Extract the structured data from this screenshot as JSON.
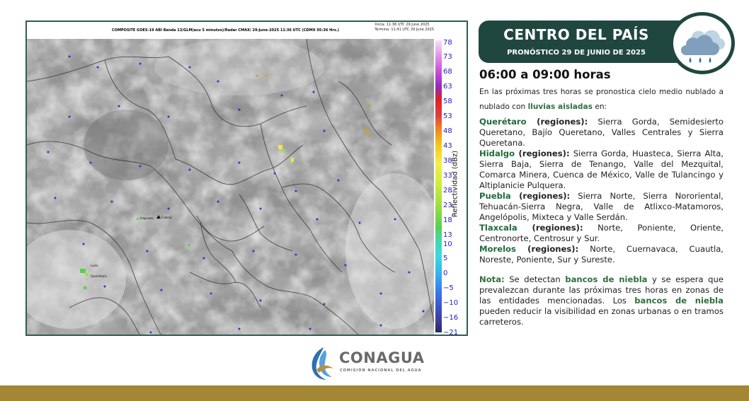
{
  "map": {
    "caption": "COMPOSITE GOES-19 ABI Banda 13/GLM(acu 5 minutos)/Radar CMAX/ 29-June-2025 11:36 UTC  (CDMX  05:36 Hrs.)",
    "start_time": "Inicia: 11:36 UTC 29 June 2025",
    "end_time": "Termina: 11:41 UTC 29 June 2025",
    "scale_label": "Reflectividad (dBz)",
    "scale_ticks": [
      "78",
      "73",
      "68",
      "63",
      "58",
      "53",
      "48",
      "43",
      "38",
      "33",
      "28",
      "23",
      "18",
      "13",
      "10",
      "5",
      "0",
      "−5",
      "−10",
      "−16",
      "−21"
    ],
    "places": {
      "cabral": "Cabral",
      "irapuato": "Irapuato",
      "leon": "León",
      "queretaro": "Querétaro"
    }
  },
  "banner": {
    "title": "CENTRO DEL PAÍS",
    "subtitle": "PRONÓSTICO 29 DE JUNIO DE 2025",
    "icon": "cloud-rain-icon",
    "color": "#20473f"
  },
  "forecast": {
    "time_range": "06:00 a 09:00 horas",
    "intro_a": "En las próximas tres horas se pronostica cielo medio nublado a nublado con ",
    "intro_highlight": "lluvias aisladas",
    "intro_b": " en:",
    "regions": [
      {
        "state": "Querétaro",
        "tag": " (regiones):",
        "list": " Sierra Gorda, Semidesierto Queretano, Bajío Queretano, Valles Centrales y Sierra Queretana."
      },
      {
        "state": "Hidalgo",
        "tag": " (regiones):",
        "list": " Sierra Gorda, Huasteca, Sierra Alta, Sierra Baja, Sierra de Tenango, Valle del Mezquital, Comarca Minera, Cuenca de México, Valle de Tulancingo y Altiplanicie Pulquera."
      },
      {
        "state": "Puebla",
        "tag": " (regiones):",
        "list": " Sierra Norte, Sierra Nororiental, Tehuacán-Sierra Negra, Valle de Atlixco-Matamoros, Angelópolis, Mixteca y Valle Serdán."
      },
      {
        "state": "Tlaxcala",
        "tag": " (regiones):",
        "list": " Norte, Poniente, Oriente, Centronorte, Centrosur y Sur."
      },
      {
        "state": "Morelos",
        "tag": " (regiones):",
        "list": " Norte, Cuernavaca, Cuautla, Noreste, Poniente, Sur y Sureste."
      }
    ],
    "note": {
      "label": "Nota:",
      "a": " Se detectan ",
      "h1": "bancos de niebla",
      "b": " y se espera que prevalezcan durante las próximas tres horas en zonas de las entidades mencionadas. Los ",
      "h2": "bancos de niebla",
      "c": " pueden reducir la visibilidad en zonas urbanas o en tramos carreteros."
    }
  },
  "footer": {
    "logo_text": "CONAGUA",
    "logo_sub": "COMISIÓN NACIONAL DEL AGUA",
    "bar_color": "#a48734"
  }
}
